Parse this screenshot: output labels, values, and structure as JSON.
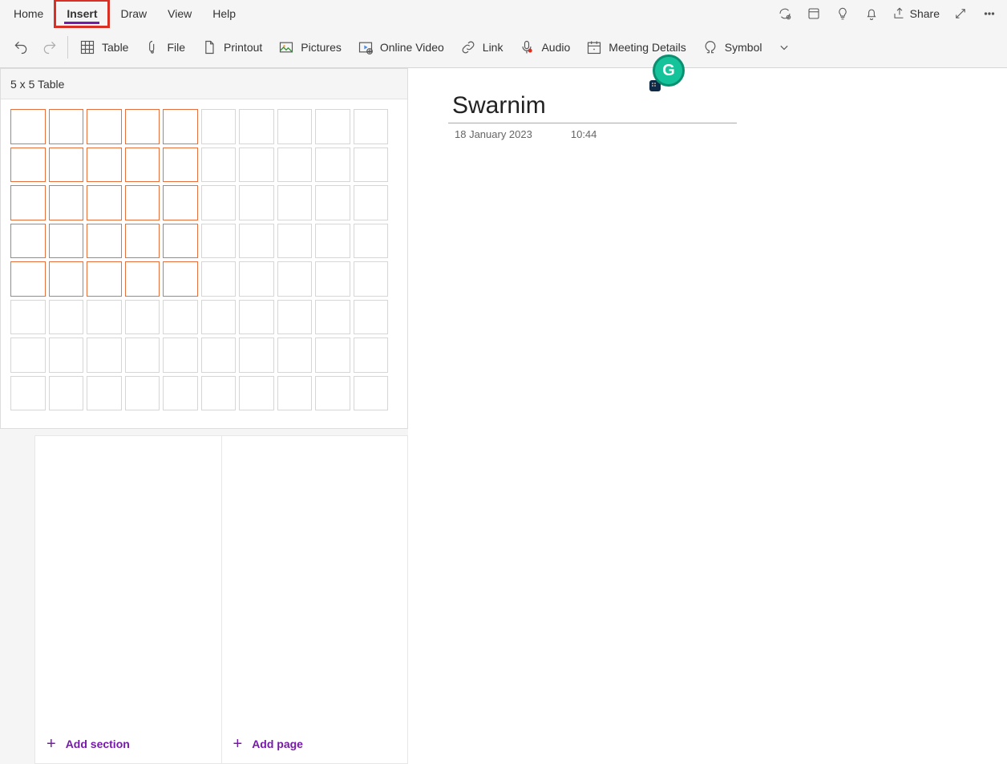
{
  "menu": {
    "home": "Home",
    "insert": "Insert",
    "draw": "Draw",
    "view": "View",
    "help": "Help",
    "share": "Share"
  },
  "ribbon": {
    "table": "Table",
    "file": "File",
    "printout": "Printout",
    "pictures": "Pictures",
    "online_video": "Online Video",
    "link": "Link",
    "audio": "Audio",
    "meeting_details": "Meeting Details",
    "symbol": "Symbol"
  },
  "table_picker": {
    "label": "5 x 5 Table",
    "rows": 8,
    "cols": 10,
    "sel_rows": 5,
    "sel_cols": 5
  },
  "page": {
    "title": "Swarnim",
    "date": "18 January 2023",
    "time": "10:44"
  },
  "bottom": {
    "add_section": "Add section",
    "add_page": "Add page"
  }
}
